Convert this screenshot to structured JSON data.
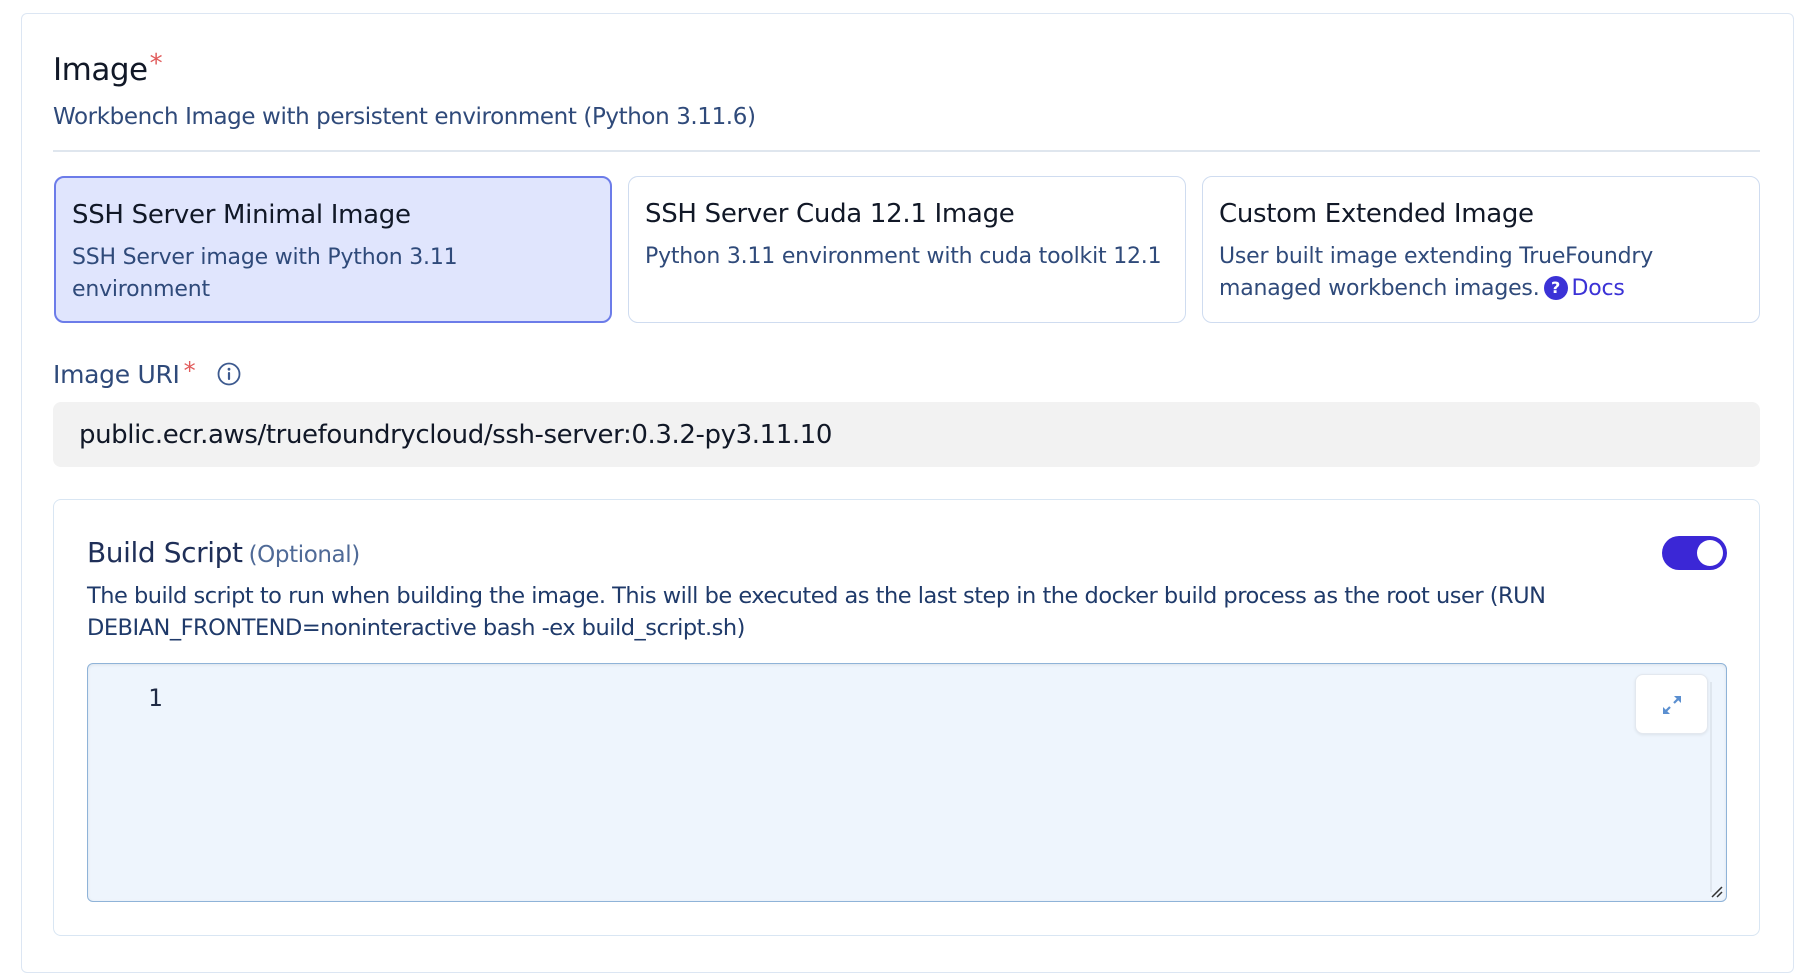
{
  "image_section": {
    "title": "Image",
    "required_mark": "*",
    "description": "Workbench Image with persistent environment (Python 3.11.6)"
  },
  "image_options": [
    {
      "title": "SSH Server Minimal Image",
      "description": "SSH Server image with Python 3.11 environment",
      "selected": true
    },
    {
      "title": "SSH Server Cuda 12.1 Image",
      "description": "Python 3.11 environment with cuda toolkit 12.1",
      "selected": false
    },
    {
      "title": "Custom Extended Image",
      "description": "User built image extending TrueFoundry managed workbench images.",
      "link_label": "Docs",
      "help_icon": "?",
      "selected": false
    }
  ],
  "image_uri": {
    "label": "Image URI",
    "required_mark": "*",
    "value": "public.ecr.aws/truefoundrycloud/ssh-server:0.3.2-py3.11.10"
  },
  "build_script": {
    "title": "Build Script",
    "optional_label": "(Optional)",
    "enabled": true,
    "description": "The build script to run when building the image. This will be executed as the last step in the docker build process as the root user (RUN DEBIAN_FRONTEND=noninteractive bash -ex build_script.sh)",
    "editor": {
      "line_number": "1",
      "content": ""
    }
  },
  "colors": {
    "accent": "#3b27d6",
    "selected_card_bg": "#e0e5fd",
    "selected_card_border": "#6c7ce9",
    "required": "#e15b5b",
    "editor_bg": "#eef5fd"
  }
}
